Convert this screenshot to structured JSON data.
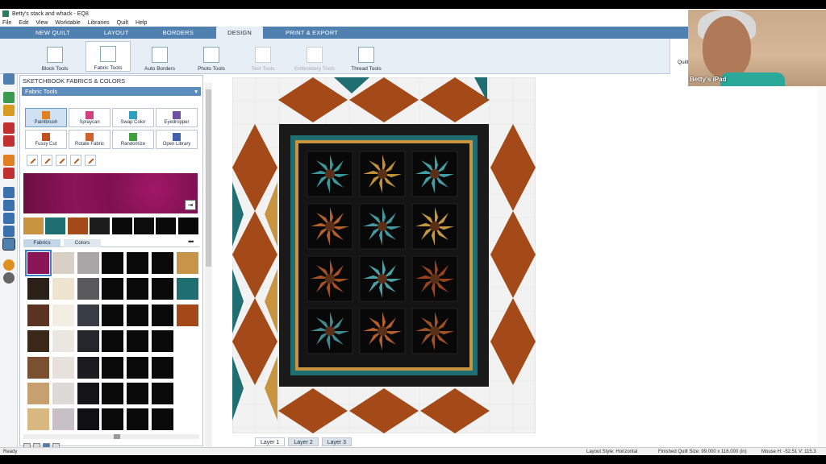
{
  "window": {
    "title": "Betty's stack and whack - EQ8"
  },
  "menu": [
    "File",
    "Edit",
    "View",
    "Worktable",
    "Libraries",
    "Quilt",
    "Help"
  ],
  "tabs": [
    "NEW QUILT",
    "LAYOUT",
    "BORDERS",
    "DESIGN",
    "PRINT & EXPORT"
  ],
  "active_tab": "DESIGN",
  "ribbon": [
    {
      "label": "Block Tools",
      "state": "normal"
    },
    {
      "label": "Fabric Tools",
      "state": "active"
    },
    {
      "label": "Auto Borders",
      "state": "normal"
    },
    {
      "label": "Photo Tools",
      "state": "normal"
    },
    {
      "label": "Text Tools",
      "state": "disabled"
    },
    {
      "label": "Embroidery Tools",
      "state": "disabled"
    },
    {
      "label": "Thread Tools",
      "state": "normal"
    }
  ],
  "ribbon_right_label": "Quilt",
  "panel": {
    "title": "SKETCHBOOK FABRICS & COLORS",
    "tools_header": "Fabric Tools",
    "tools": [
      "Paintbrush",
      "Spraycan",
      "Swap Color",
      "Eyedropper",
      "Fussy Cut",
      "Rotate Fabric",
      "Randomize",
      "Open Library"
    ],
    "active_tool": "Paintbrush",
    "fabric_tabs": [
      "Fabrics",
      "Colors"
    ],
    "recent_swatches": [
      "#c89440",
      "#1f6f72",
      "#a44a18",
      "#1c1c1c",
      "#0a0a0a",
      "#0c0c0c",
      "#0a0a0a",
      "#080808"
    ],
    "fabric_columns": [
      [
        "#8a1657",
        "#2a2018",
        "#5a3420",
        "#3a2818",
        "#7a5030",
        "#c8a070",
        "#d8b880"
      ],
      [
        "#d8d0c4",
        "#efe4d0",
        "#f4ede4",
        "#ece6e0",
        "#e8e0dc",
        "#dcdad6",
        "#c8c0c4"
      ],
      [
        "#a8a6a6",
        "#5a5a5c",
        "#383c44",
        "#24262c",
        "#1c1c20",
        "#141416",
        "#101012"
      ],
      [
        "#0a0a0a",
        "#0a0a0a",
        "#0a0a0a",
        "#0a0a0a",
        "#0a0a0a",
        "#0a0a0a",
        "#0a0a0a"
      ],
      [
        "#0a0a0a",
        "#0a0a0a",
        "#0a0a0a",
        "#0a0a0a",
        "#0a0a0a",
        "#0a0a0a",
        "#0a0a0a"
      ],
      [
        "#0a0a0a",
        "#0a0a0a",
        "#0a0a0a",
        "#0a0a0a",
        "#0a0a0a",
        "#0a0a0a",
        "#0a0a0a"
      ],
      [
        "#c89448",
        "#1f6f72",
        "#a4481a"
      ]
    ]
  },
  "quilt": {
    "border_fabric": "#a44a18",
    "gold_fabric": "#c89440",
    "teal_fabric": "#1f6f72",
    "dark_fabric": "#1a1a1a",
    "background_fabric": "#f2f2f2",
    "block_rows": 4,
    "block_cols": 3,
    "block_colors": [
      [
        "#3fa8a8",
        "#d4a040",
        "#48b0b8"
      ],
      [
        "#c86a30",
        "#4aa8b0",
        "#d8a848"
      ],
      [
        "#b85a28",
        "#58b0b8",
        "#a84a20"
      ],
      [
        "#4898a0",
        "#c86830",
        "#b05a28"
      ]
    ]
  },
  "layers": [
    "Layer 1",
    "Layer 2",
    "Layer 3"
  ],
  "active_layer": "Layer 1",
  "status": {
    "left": "Ready",
    "layout_style": "Layout Style: Horizontal",
    "finished_size": "Finished Quilt Size: 99.000 x 116.000 (in)",
    "mouse": "Mouse  H: -52.51   V: 115.3"
  },
  "webcam": {
    "label": "Betty's iPad"
  }
}
